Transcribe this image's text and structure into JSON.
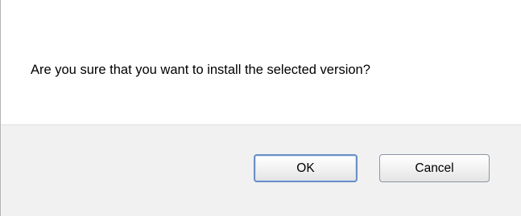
{
  "dialog": {
    "message": "Are you sure that you want to install the selected version?",
    "buttons": {
      "ok_label": "OK",
      "cancel_label": "Cancel"
    }
  },
  "colors": {
    "background": "#ffffff",
    "button_bar": "#f1f1f1",
    "default_button_border": "#6b8fc4"
  }
}
